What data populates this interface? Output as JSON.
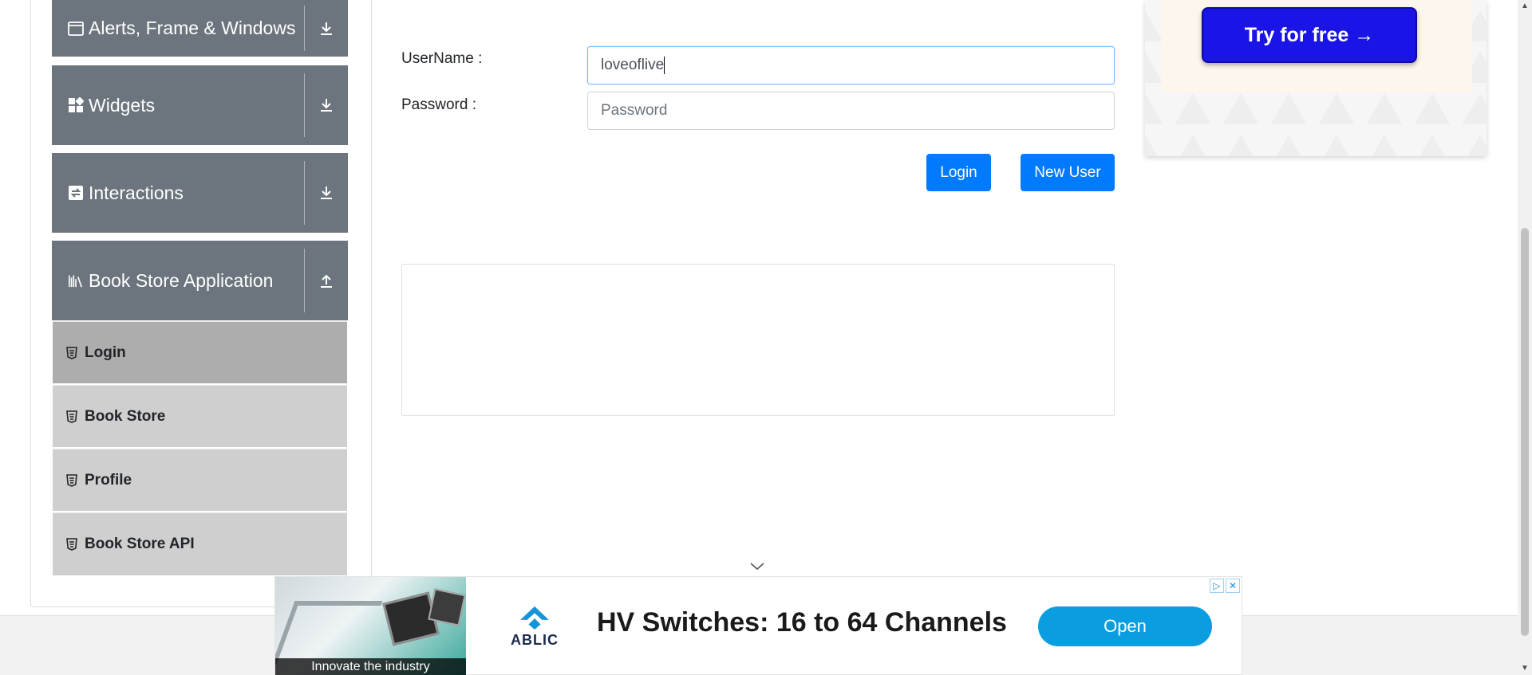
{
  "sidebar": {
    "groups": [
      {
        "label": "Alerts, Frame & Windows",
        "icon": "window-icon",
        "toggle": "download-arrow-icon"
      },
      {
        "label": "Widgets",
        "icon": "widgets-grid-icon",
        "toggle": "download-arrow-icon"
      },
      {
        "label": "Interactions",
        "icon": "interactions-icon",
        "toggle": "download-arrow-icon"
      },
      {
        "label": "Book Store Application",
        "icon": "books-icon",
        "toggle": "upload-arrow-icon"
      }
    ],
    "items": [
      {
        "label": "Login",
        "active": true
      },
      {
        "label": "Book Store"
      },
      {
        "label": "Profile"
      },
      {
        "label": "Book Store API"
      }
    ]
  },
  "form": {
    "username_label": "UserName :",
    "username_value": "loveoflive",
    "password_label": "Password :",
    "password_placeholder": "Password",
    "login_button": "Login",
    "new_user_button": "New User"
  },
  "right_ad": {
    "button_label": "Try for free →"
  },
  "bottom_ad": {
    "caption": "Innovate the industry",
    "brand": "ABLIC",
    "headline": "HV Switches: 16 to 64 Channels",
    "cta": "Open"
  },
  "colors": {
    "primary": "#007bff",
    "sidebar_header": "#6c757d",
    "sidebar_item": "#cfcfcf",
    "sidebar_item_active": "#adadad",
    "ad_cta": "#0a9ee0",
    "try_button": "#1a14e6"
  }
}
